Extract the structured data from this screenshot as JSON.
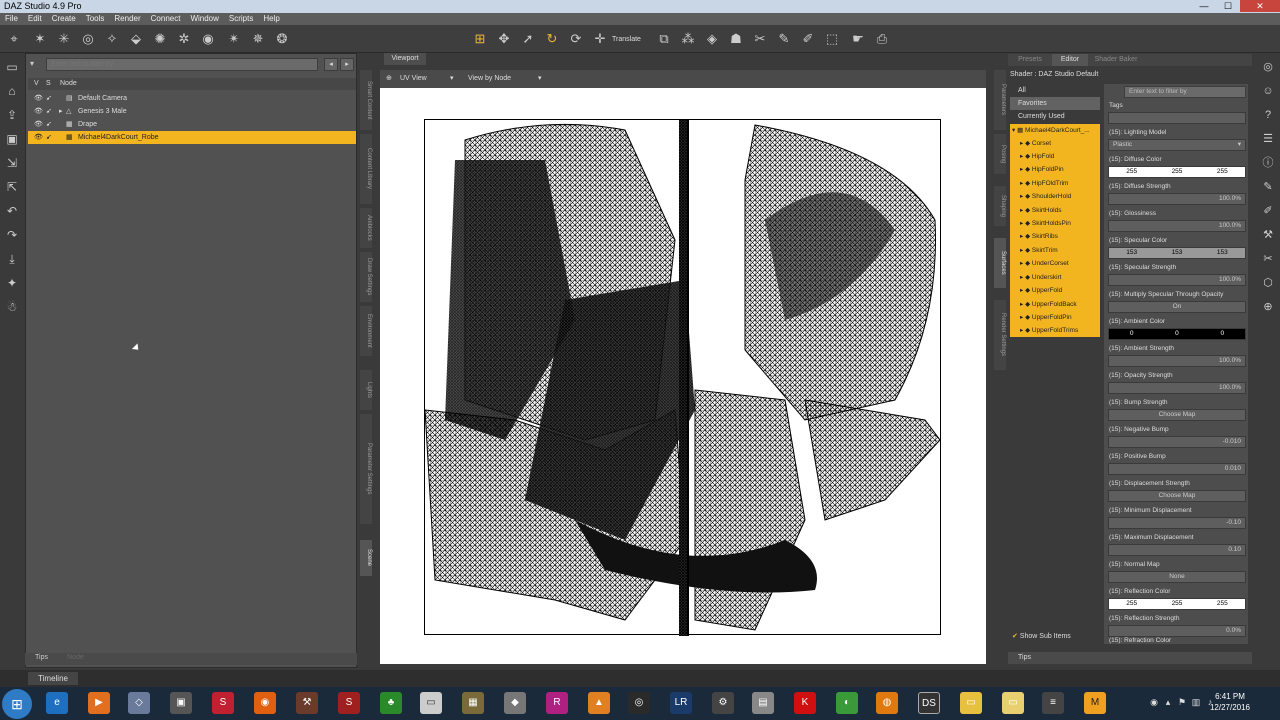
{
  "window": {
    "title": "DAZ Studio 4.9 Pro",
    "minimize": "—",
    "maximize": "☐",
    "close": "✕"
  },
  "menu": [
    "File",
    "Edit",
    "Create",
    "Tools",
    "Render",
    "Connect",
    "Window",
    "Scripts",
    "Help"
  ],
  "toolbar": {
    "translate_label": "Translate"
  },
  "scene": {
    "filter_placeholder": "Enter text to filter by",
    "col_v": "V",
    "col_s": "S",
    "col_node": "Node",
    "nodes": [
      {
        "label": "Default Camera",
        "selected": false
      },
      {
        "label": "Genesis 3 Male",
        "selected": false
      },
      {
        "label": "Drape",
        "selected": false
      },
      {
        "label": "Michael4DarkCourt_Robe",
        "selected": true
      }
    ],
    "tabs": [
      "Tips",
      "Node"
    ]
  },
  "left_vertical_tabs": [
    "Smart Content",
    "Content Library",
    "Aniblocks",
    "Draw Settings",
    "Environment",
    "Lights",
    "Parameter Settings",
    "Scene"
  ],
  "viewport": {
    "tab": "Viewport",
    "view_select": "UV View",
    "view_by": "View by Node"
  },
  "right_vertical_tabs": [
    "Parameters",
    "Posing",
    "Shaping",
    "Surfaces",
    "Render Settings"
  ],
  "right": {
    "tabs": [
      "Presets",
      "Editor",
      "Shader Baker"
    ],
    "active_tab": "Editor",
    "shader_label": "Shader : DAZ Studio Default",
    "categories": [
      "All",
      "Favorites",
      "Currently Used"
    ],
    "selected_category": "Favorites",
    "filter_placeholder": "Enter text to filter by",
    "root": "Michael4DarkCourt_...",
    "surfaces": [
      "Corset",
      "HipFold",
      "HipFoldPin",
      "HipFOldTrim",
      "ShoulderHold",
      "SkirtHolds",
      "SkirtHoldsPin",
      "SkirtRibs",
      "SkirtTrim",
      "UnderCorset",
      "Underskirt",
      "UpperFold",
      "UpperFoldBack",
      "UpperFoldPin",
      "UpperFoldTrims"
    ],
    "properties": [
      {
        "label": "Tags",
        "value": ""
      },
      {
        "label": "(15): Lighting Model",
        "value": "Plastic"
      },
      {
        "label": "(15): Diffuse Color",
        "r": "255",
        "g": "255",
        "b": "255"
      },
      {
        "label": "(15): Diffuse Strength",
        "value": "100.0%"
      },
      {
        "label": "(15): Glossiness",
        "value": "100.0%"
      },
      {
        "label": "(15): Specular Color",
        "r": "153",
        "g": "153",
        "b": "153"
      },
      {
        "label": "(15): Specular Strength",
        "value": "100.0%"
      },
      {
        "label": "(15): Multiply Specular Through Opacity",
        "value": "On"
      },
      {
        "label": "(15): Ambient Color",
        "r": "0",
        "g": "0",
        "b": "0"
      },
      {
        "label": "(15): Ambient Strength",
        "value": "100.0%"
      },
      {
        "label": "(15): Opacity Strength",
        "value": "100.0%"
      },
      {
        "label": "(15): Bump Strength",
        "value": "Choose Map"
      },
      {
        "label": "(15): Negative Bump",
        "value": "-0.010"
      },
      {
        "label": "(15): Positive Bump",
        "value": "0.010"
      },
      {
        "label": "(15): Displacement Strength",
        "value": "Choose Map"
      },
      {
        "label": "(15): Minimum Displacement",
        "value": "-0.10"
      },
      {
        "label": "(15): Maximum Displacement",
        "value": "0.10"
      },
      {
        "label": "(15): Normal Map",
        "value": "None"
      },
      {
        "label": "(15): Reflection Color",
        "r": "255",
        "g": "255",
        "b": "255"
      },
      {
        "label": "(15): Reflection Strength",
        "value": "0.0%"
      },
      {
        "label": "(15): Refraction Color",
        "value": ""
      }
    ],
    "show_sub_items": "Show Sub Items",
    "tips": "Tips"
  },
  "timeline": "Timeline",
  "clock": {
    "time": "6:41 PM",
    "date": "12/27/2016"
  },
  "colors": {
    "accent": "#f3b51f",
    "panel": "#515151",
    "bg": "#3a3a3a"
  }
}
